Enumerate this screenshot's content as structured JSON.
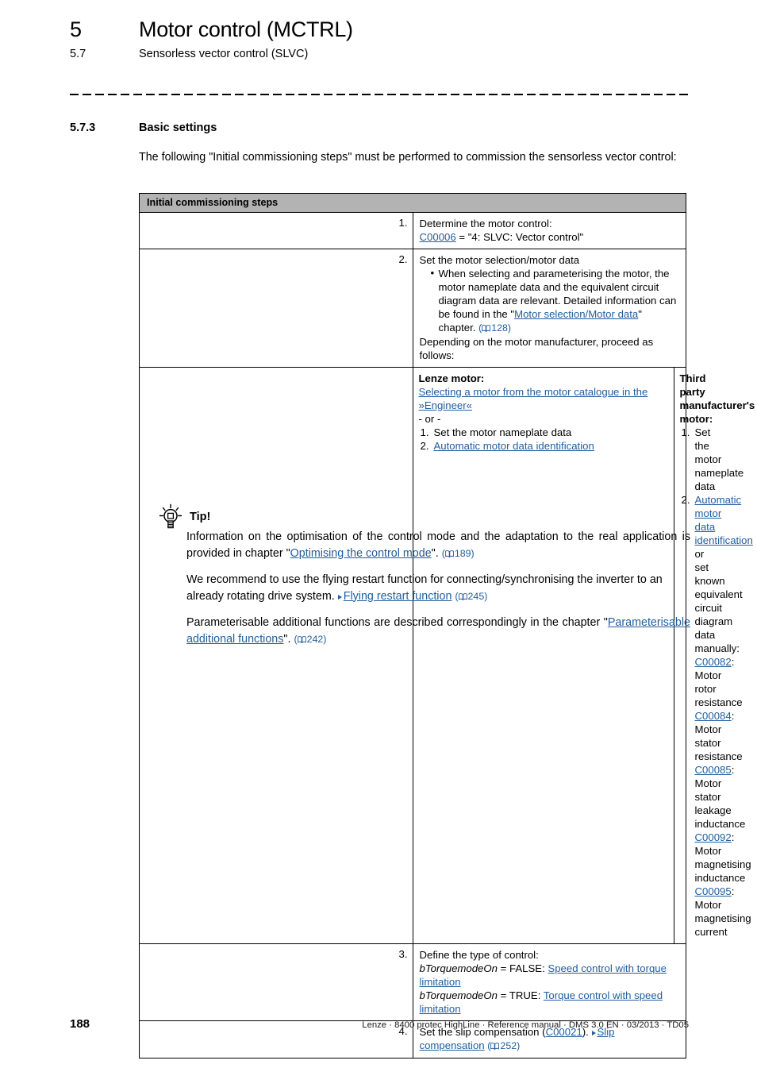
{
  "header": {
    "chapter_number": "5",
    "chapter_title": "Motor control (MCTRL)",
    "section_number": "5.7",
    "section_title": "Sensorless vector control (SLVC)"
  },
  "section": {
    "number": "5.7.3",
    "title": "Basic settings",
    "intro": "The following \"Initial commissioning steps\" must be performed to commission the sensorless vector control:"
  },
  "table": {
    "header": "Initial commissioning steps",
    "rows": {
      "r1": {
        "num": "1.",
        "line1": "Determine the motor control:",
        "code": "C00006",
        "value": " = \"4: SLVC: Vector control\""
      },
      "r2": {
        "num": "2.",
        "line1": "Set the motor selection/motor data",
        "bullet_pre": "When selecting and parameterising the motor, the motor nameplate data and the equivalent circuit diagram data are relevant. Detailed information can be found in the \"",
        "bullet_link": "Motor selection/Motor data",
        "bullet_post": "\" chapter. ",
        "bullet_page": "128",
        "line_after": "Depending on the motor manufacturer, proceed as follows:",
        "left": {
          "heading": "Lenze motor:",
          "link": "Selecting a motor from the motor catalogue in the »Engineer«",
          "or": "- or -",
          "item1": "Set the motor nameplate data",
          "item2_link": "Automatic motor data identification"
        },
        "right": {
          "heading": "Third party manufacturer's motor:",
          "item1": "Set the motor nameplate data",
          "item2_link": "Automatic motor data identification",
          "item2_post": " or set known equivalent circuit diagram data manually:",
          "params": [
            {
              "code": "C00082",
              "desc": ": Motor rotor resistance"
            },
            {
              "code": "C00084",
              "desc": ": Motor stator resistance"
            },
            {
              "code": "C00085",
              "desc": ": Motor stator leakage inductance"
            },
            {
              "code": "C00092",
              "desc": ": Motor magnetising inductance"
            },
            {
              "code": "C00095",
              "desc": ": Motor magnetising current"
            }
          ]
        }
      },
      "r3": {
        "num": "3.",
        "line1": "Define the type of control:",
        "var": "bTorquemodeOn",
        "false_eq": " = FALSE: ",
        "false_link": "Speed control with torque limitation",
        "true_eq": " = TRUE: ",
        "true_link": "Torque control with speed limitation"
      },
      "r4": {
        "num": "4.",
        "pre": "Set the slip compensation (",
        "code": "C00021",
        "mid": "). ",
        "link": "Slip compensation",
        "page": "252"
      }
    }
  },
  "tip": {
    "label": "Tip!",
    "p1_pre": "Information on the optimisation of the control mode and the adaptation to the real application is provided in chapter \"",
    "p1_link": "Optimising the control mode",
    "p1_post": "\". ",
    "p1_page": "189",
    "p2_pre": "We recommend to use the flying restart function for connecting/synchronising the inverter to an already rotating drive system. ",
    "p2_link": "Flying restart function",
    "p2_page": "245",
    "p3_pre": "Parameterisable additional functions are described correspondingly in the chapter \"",
    "p3_link": "Parameterisable additional functions",
    "p3_post": "\". ",
    "p3_page": "242"
  },
  "footer": {
    "page_number": "188",
    "text": "Lenze · 8400 protec HighLine · Reference manual · DMS 3.0 EN · 03/2013 · TD05"
  },
  "colors": {
    "link": "#215E9E",
    "table_header_bg": "#b3b3b3"
  }
}
